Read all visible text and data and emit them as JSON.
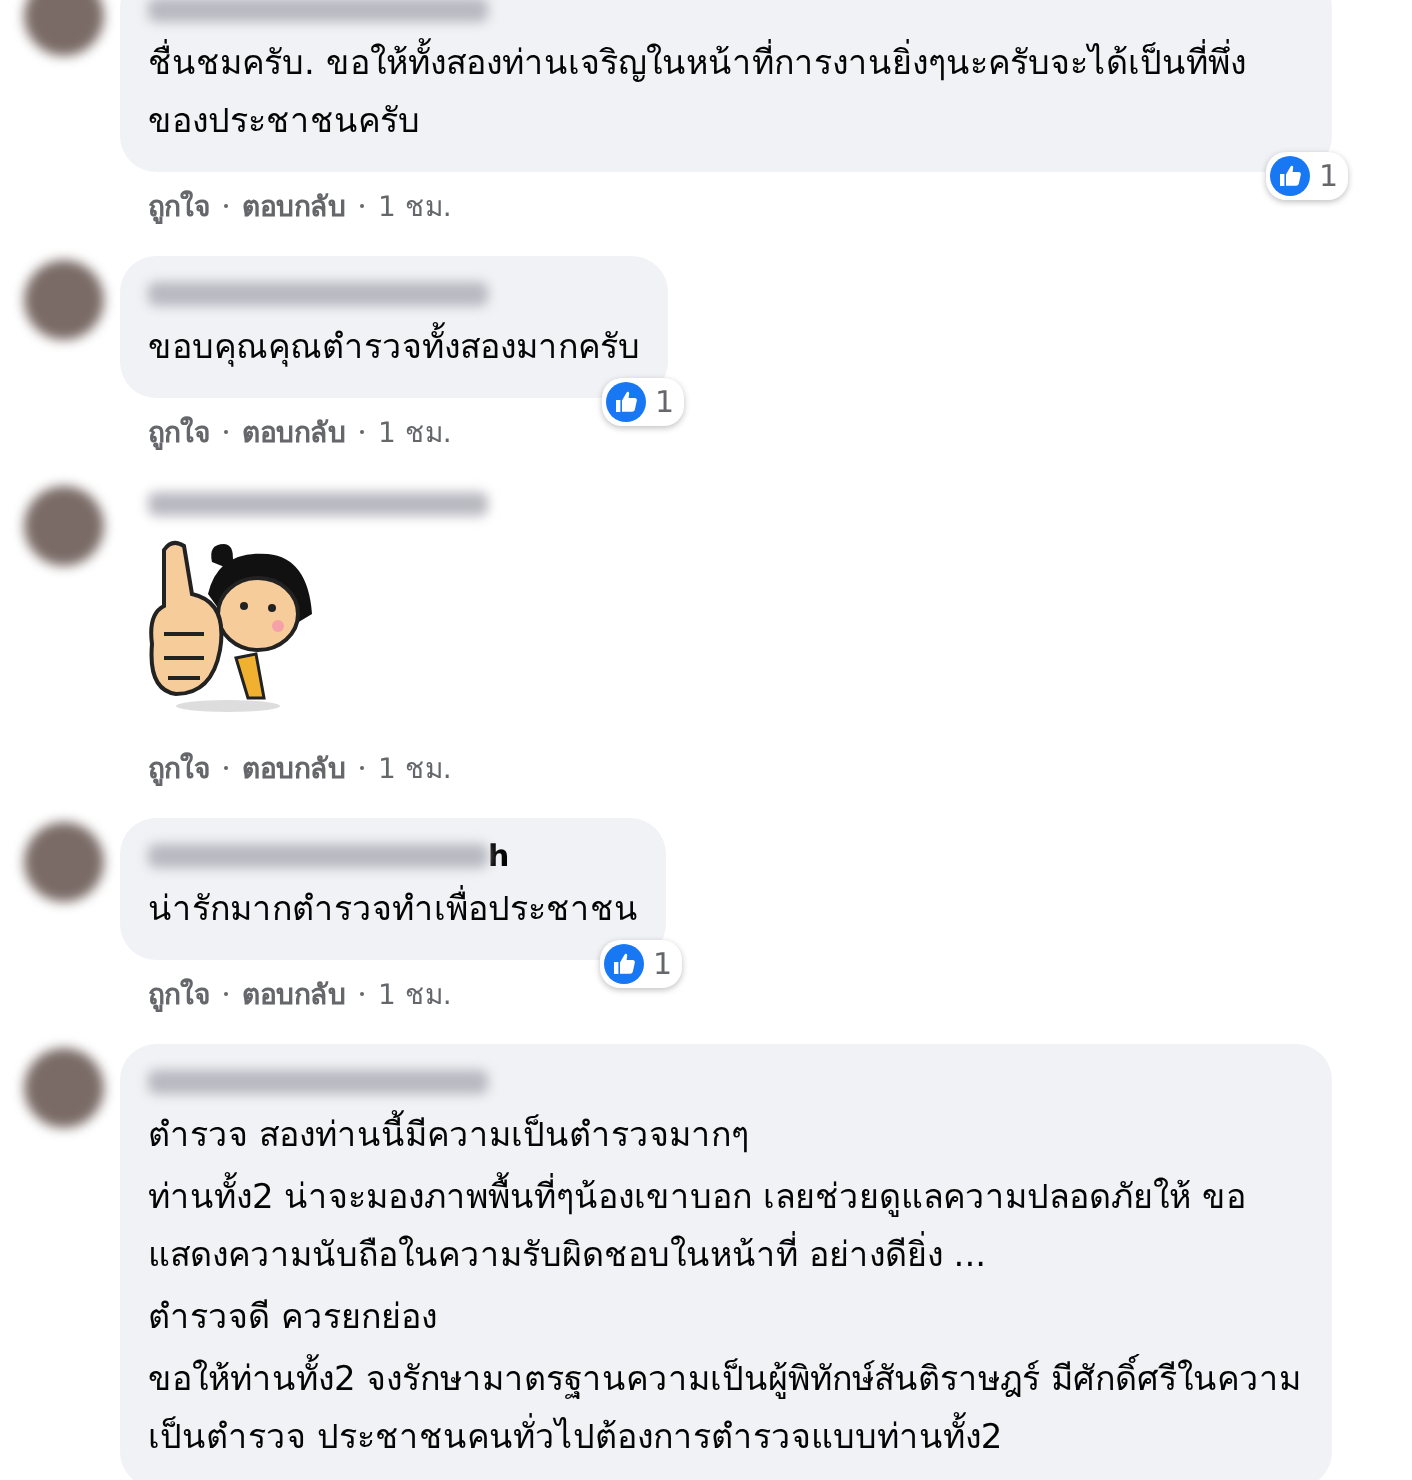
{
  "comments": [
    {
      "kind": "text",
      "paragraphs": [
        "ชื่นชมครับ. ขอให้ทั้งสองท่านเจริญในหน้าที่การงานยิ่งๆนะครับจะได้เป็นที่พึ่งของประชาชนครับ"
      ],
      "reaction_count": "1",
      "actions": [
        "ถูกใจ",
        "ตอบกลับ",
        "1 ชม."
      ]
    },
    {
      "kind": "text",
      "paragraphs": [
        "ขอบคุณคุณตำรวจทั้งสองมากครับ"
      ],
      "reaction_count": "1",
      "actions": [
        "ถูกใจ",
        "ตอบกลับ",
        "1 ชม."
      ]
    },
    {
      "kind": "sticker",
      "actions": [
        "ถูกใจ",
        "ตอบกลับ",
        "1 ชม."
      ]
    },
    {
      "kind": "text",
      "name_tail": "h",
      "paragraphs": [
        "น่ารักมากตำรวจทำเพื่อประชาชน"
      ],
      "reaction_count": "1",
      "actions": [
        "ถูกใจ",
        "ตอบกลับ",
        "1 ชม."
      ]
    },
    {
      "kind": "text",
      "paragraphs": [
        "ตำรวจ สองท่านนี้มีความเป็นตำรวจมากๆ",
        "ท่านทั้ง2 น่าจะมองภาพพื้นที่ๆน้องเขาบอก เลยช่วยดูแลความปลอดภัยให้ ขอแสดงความนับถือในความรับผิดชอบในหน้าที่ อย่างดียิ่ง ...",
        "ตำรวจดี ควรยกย่อง",
        "ขอให้ท่านทั้ง2 จงรักษามาตรฐานความเป็นผู้พิทักษ์สันติราษฎร์ มีศักดิ์ศรีในความเป็นตำรวจ ประชาชนคนทั่วไปต้องการตำรวจแบบท่านทั้ง2"
      ]
    }
  ]
}
